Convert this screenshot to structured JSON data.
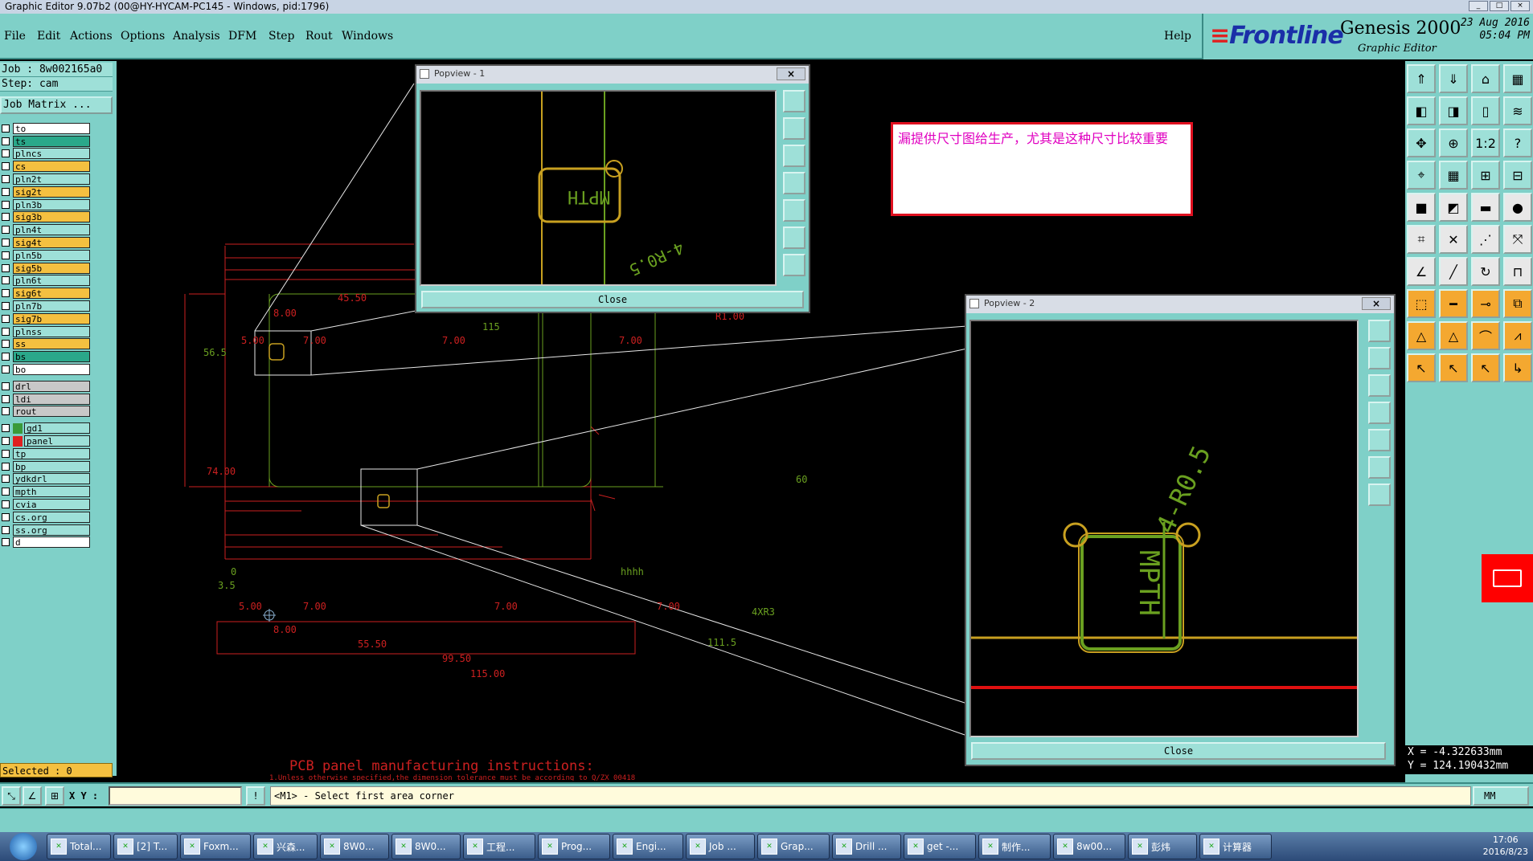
{
  "window": {
    "title": "Graphic Editor 9.07b2 (00@HY-HYCAM-PC145 - Windows, pid:1796)"
  },
  "menu": [
    {
      "label": "File"
    },
    {
      "label": "Edit"
    },
    {
      "label": "Actions"
    },
    {
      "label": "Options"
    },
    {
      "label": "Analysis"
    },
    {
      "label": "DFM"
    },
    {
      "label": "Step"
    },
    {
      "label": "Rout"
    },
    {
      "label": "Windows"
    }
  ],
  "help_label": "Help",
  "brand": {
    "logo": "Frontline",
    "product": "Genesis 2000",
    "sub": "Graphic Editor",
    "date": "23 Aug 2016",
    "time": "05:04 PM"
  },
  "job": {
    "job_line": "Job : 8w002165a0",
    "step_line": "Step: cam",
    "matrix_label": "Job Matrix ..."
  },
  "layers": [
    {
      "name": "to",
      "color": "#ffffff"
    },
    {
      "name": "ts",
      "color": "#2aa88a"
    },
    {
      "name": "plncs",
      "color": "#9ee0d8"
    },
    {
      "name": "cs",
      "color": "#f4c040"
    },
    {
      "name": "pln2t",
      "color": "#9ee0d8"
    },
    {
      "name": "sig2t",
      "color": "#f4c040"
    },
    {
      "name": "pln3b",
      "color": "#9ee0d8"
    },
    {
      "name": "sig3b",
      "color": "#f4c040"
    },
    {
      "name": "pln4t",
      "color": "#9ee0d8"
    },
    {
      "name": "sig4t",
      "color": "#f4c040"
    },
    {
      "name": "pln5b",
      "color": "#9ee0d8"
    },
    {
      "name": "sig5b",
      "color": "#f4c040"
    },
    {
      "name": "pln6t",
      "color": "#9ee0d8"
    },
    {
      "name": "sig6t",
      "color": "#f4c040"
    },
    {
      "name": "pln7b",
      "color": "#9ee0d8"
    },
    {
      "name": "sig7b",
      "color": "#f4c040"
    },
    {
      "name": "plnss",
      "color": "#9ee0d8"
    },
    {
      "name": "ss",
      "color": "#f4c040"
    },
    {
      "name": "bs",
      "color": "#2aa88a"
    },
    {
      "name": "bo",
      "color": "#ffffff"
    },
    {
      "name": "drl",
      "color": "#c8c8c8",
      "gap": true
    },
    {
      "name": "ldi",
      "color": "#c8c8c8"
    },
    {
      "name": "rout",
      "color": "#c8c8c8"
    },
    {
      "name": "gd1",
      "color": "#9ee0d8",
      "gap": true,
      "swatch": "#3a9a3a"
    },
    {
      "name": "panel",
      "color": "#9ee0d8",
      "swatch": "#e02020"
    },
    {
      "name": "tp",
      "color": "#9ee0d8"
    },
    {
      "name": "bp",
      "color": "#9ee0d8"
    },
    {
      "name": "ydkdrl",
      "color": "#9ee0d8"
    },
    {
      "name": "mpth",
      "color": "#9ee0d8"
    },
    {
      "name": "cvia",
      "color": "#9ee0d8"
    },
    {
      "name": "cs.org",
      "color": "#9ee0d8"
    },
    {
      "name": "ss.org",
      "color": "#9ee0d8"
    },
    {
      "name": "d",
      "color": "#ffffff"
    }
  ],
  "selected_label": "Selected : 0",
  "canvas": {
    "dims": [
      "45.50",
      "8.00",
      "5.00",
      "7.00",
      "7.00",
      "7.00",
      "115",
      "R1.00",
      "56.5",
      "74.00",
      "60",
      "0",
      "3.5",
      "5.00",
      "7.00",
      "7.00",
      "7.00",
      "8.00",
      "55.50",
      "99.50",
      "115.00",
      "111.5",
      "4XR3",
      "hhhh"
    ],
    "notes_title": "PCB panel manufacturing instructions:",
    "notes_line": "1.Unless otherwise specified,the dimension tolerance must be according to Q/ZX 00418"
  },
  "popup1": {
    "title": "Popview - 1",
    "close_label": "Close",
    "close_x": "×",
    "label_text": "MPTH",
    "label_text2": "4-R0.5"
  },
  "popup2": {
    "title": "Popview - 2",
    "close_label": "Close",
    "close_x": "×",
    "label_text": "MPTH",
    "label_text2": "4-R0.5"
  },
  "note": {
    "text": "漏提供尺寸图给生产，尤其是这种尺寸比较重要"
  },
  "coords": {
    "x": "X = -4.322633mm",
    "y": "Y = 124.190432mm"
  },
  "cmd": {
    "xy_label": "X Y :",
    "xy_value": "",
    "message": "<M1> - Select first area corner",
    "units": "MM"
  },
  "taskbar": [
    {
      "label": "Total..."
    },
    {
      "label": "[2] T..."
    },
    {
      "label": "Foxm..."
    },
    {
      "label": "兴森..."
    },
    {
      "label": "8W0..."
    },
    {
      "label": "8W0..."
    },
    {
      "label": "工程..."
    },
    {
      "label": "Prog..."
    },
    {
      "label": "Engi..."
    },
    {
      "label": "Job ..."
    },
    {
      "label": "Grap..."
    },
    {
      "label": "Drill ..."
    },
    {
      "label": "get -..."
    },
    {
      "label": "制作..."
    },
    {
      "label": "8w00..."
    },
    {
      "label": "彭炜"
    },
    {
      "label": "计算器"
    }
  ],
  "clock": {
    "time": "17:06",
    "date": "2016/8/23"
  },
  "colors": {
    "panel": "#7fd0c8",
    "dim_red": "#cc2020",
    "outline": "#e8e8a0",
    "trace_olive": "#c8a020",
    "trace_green": "#6aa020"
  }
}
